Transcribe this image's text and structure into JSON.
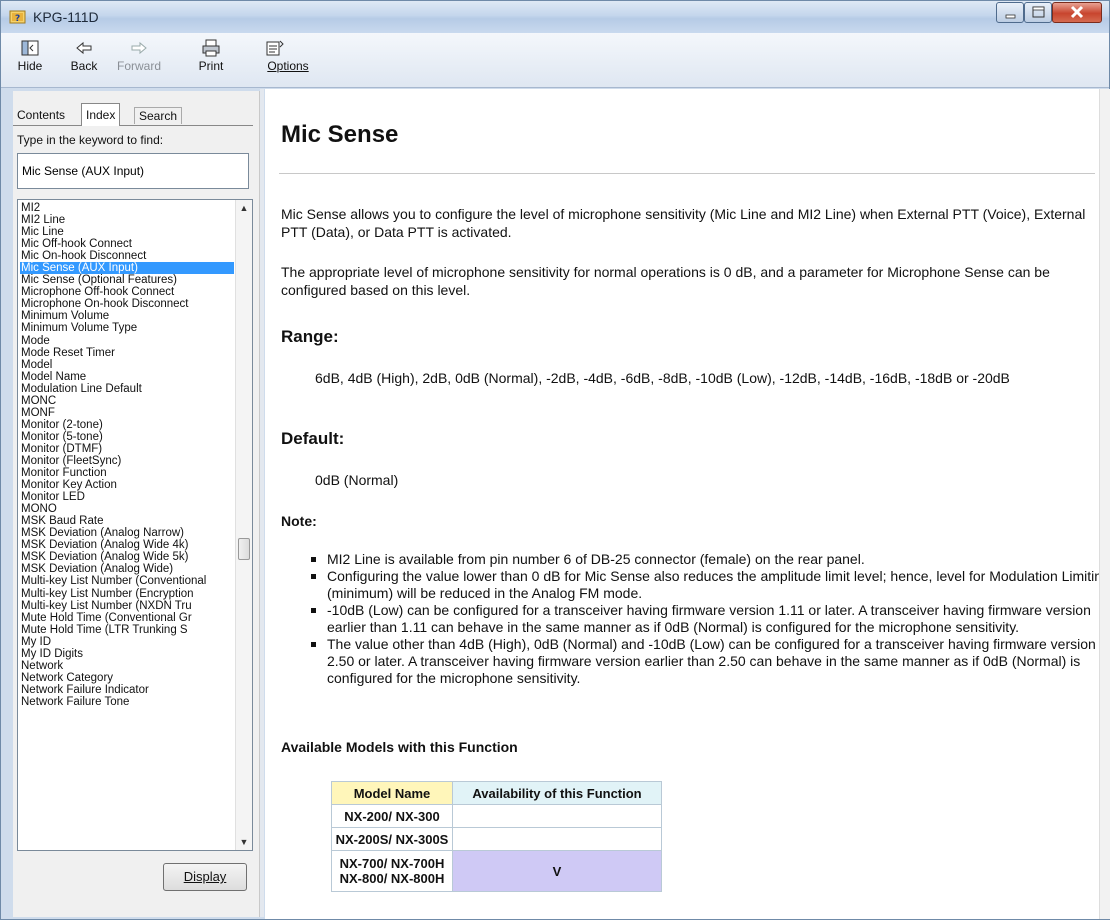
{
  "window": {
    "title": "KPG-111D"
  },
  "toolbar": {
    "hide": "Hide",
    "back": "Back",
    "forward": "Forward",
    "print": "Print",
    "options": "Options"
  },
  "nav": {
    "tabs": [
      "Contents",
      "Index",
      "Search"
    ],
    "active_tab": "Index",
    "keyword_label": "Type in the keyword to find:",
    "keyword_value": "Mic Sense (AUX Input)",
    "display_button": "Display",
    "index_items": [
      "MI2",
      "MI2 Line",
      "Mic Line",
      "Mic Off-hook Connect",
      "Mic On-hook Disconnect",
      "Mic Sense (AUX Input)",
      "Mic Sense (Optional Features)",
      "Microphone Off-hook Connect",
      "Microphone On-hook Disconnect",
      "Minimum Volume",
      "Minimum Volume Type",
      "Mode",
      "Mode Reset Timer",
      "Model",
      "Model Name",
      "Modulation Line Default",
      "MONC",
      "MONF",
      "Monitor (2-tone)",
      "Monitor (5-tone)",
      "Monitor (DTMF)",
      "Monitor (FleetSync)",
      "Monitor Function",
      "Monitor Key Action",
      "Monitor LED",
      "MONO",
      "MSK Baud Rate",
      "MSK Deviation (Analog Narrow)",
      "MSK Deviation (Analog Wide 4k)",
      "MSK Deviation (Analog Wide 5k)",
      "MSK Deviation (Analog Wide)",
      "Multi-key List Number (Conventional",
      "Multi-key List Number (Encryption",
      "Multi-key List Number (NXDN Tru",
      "Mute Hold Time (Conventional Gr",
      "Mute Hold Time (LTR Trunking S",
      "My ID",
      "My ID Digits",
      "Network",
      "Network Category",
      "Network Failure Indicator",
      "Network Failure Tone"
    ],
    "selected_index": 5
  },
  "topic": {
    "title": "Mic Sense",
    "intro1": "Mic Sense allows you to configure the level of microphone sensitivity (Mic Line and MI2 Line) when External PTT (Voice), External PTT (Data), or Data PTT is activated.",
    "intro2": "The appropriate level of microphone sensitivity for normal operations is 0 dB, and a parameter for Microphone Sense can be configured based on this level.",
    "range_heading": "Range:",
    "range_text": "6dB, 4dB (High), 2dB, 0dB (Normal), -2dB, -4dB, -6dB, -8dB, -10dB (Low), -12dB, -14dB, -16dB, -18dB or -20dB",
    "default_heading": "Default:",
    "default_text": "0dB (Normal)",
    "note_heading": "Note:",
    "notes": [
      "MI2 Line is available from pin number 6 of DB-25 connector (female) on the rear panel.",
      "Configuring the value lower than 0 dB for Mic Sense also reduces the amplitude limit level; hence, level for Modulation Limiting (minimum) will be reduced in the Analog FM mode.",
      "-10dB (Low) can be configured for a transceiver having firmware version 1.11 or later. A transceiver having firmware version earlier than 1.11 can behave in the same manner as if 0dB (Normal) is configured for the microphone sensitivity.",
      "The value other than 4dB (High), 0dB (Normal) and -10dB (Low) can be configured for a transceiver having firmware version 2.50 or later. A transceiver having firmware version earlier than 2.50 can behave in the same manner as if 0dB (Normal) is configured for the microphone sensitivity."
    ],
    "models_heading": "Available Models with this Function",
    "table": {
      "col_model": "Model Name",
      "col_avail": "Availability of this Function",
      "rows": [
        {
          "model": "NX-200/ NX-300",
          "avail": ""
        },
        {
          "model": "NX-200S/ NX-300S",
          "avail": ""
        },
        {
          "model": "NX-700/ NX-700H\nNX-800/ NX-800H",
          "avail": "V"
        }
      ]
    }
  }
}
